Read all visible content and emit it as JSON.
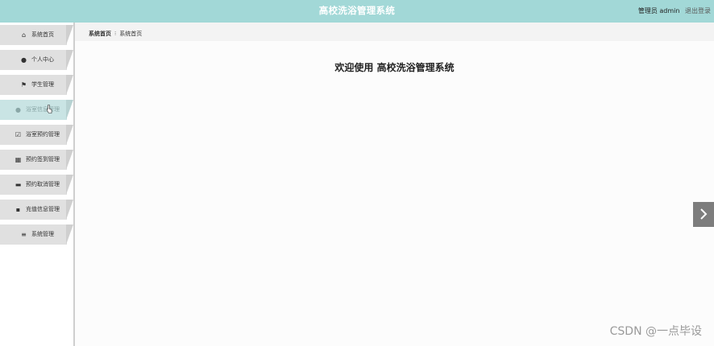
{
  "header": {
    "title": "高校洗浴管理系统",
    "role": "管理员",
    "username": "admin",
    "logout_label": "退出登录"
  },
  "sidebar": {
    "items": [
      {
        "label": "系统首页",
        "icon": "home-icon",
        "glyph": "⌂",
        "active": false
      },
      {
        "label": "个人中心",
        "icon": "person-icon",
        "glyph": "●",
        "active": false
      },
      {
        "label": "学生管理",
        "icon": "flag-icon",
        "glyph": "⚑",
        "active": false
      },
      {
        "label": "浴室信息管理",
        "icon": "pin-icon",
        "glyph": "●",
        "active": true
      },
      {
        "label": "浴室预约管理",
        "icon": "check-square-icon",
        "glyph": "☑",
        "active": false
      },
      {
        "label": "预约签到管理",
        "icon": "grid-icon",
        "glyph": "▦",
        "active": false
      },
      {
        "label": "预约取消管理",
        "icon": "comment-icon",
        "glyph": "▬",
        "active": false
      },
      {
        "label": "充值信息管理",
        "icon": "apps-icon",
        "glyph": "▪",
        "active": false
      },
      {
        "label": "系统管理",
        "icon": "menu-icon",
        "glyph": "≡",
        "active": false
      }
    ]
  },
  "breadcrumb": {
    "home": "系统首页",
    "separator": "⁝",
    "current": "系统首页"
  },
  "main": {
    "welcome": "欢迎使用 高校洗浴管理系统"
  },
  "watermark": "CSDN @一点毕设",
  "colors": {
    "header_bg": "#a2d8d7",
    "active_item_bg": "#c9e4e4"
  }
}
